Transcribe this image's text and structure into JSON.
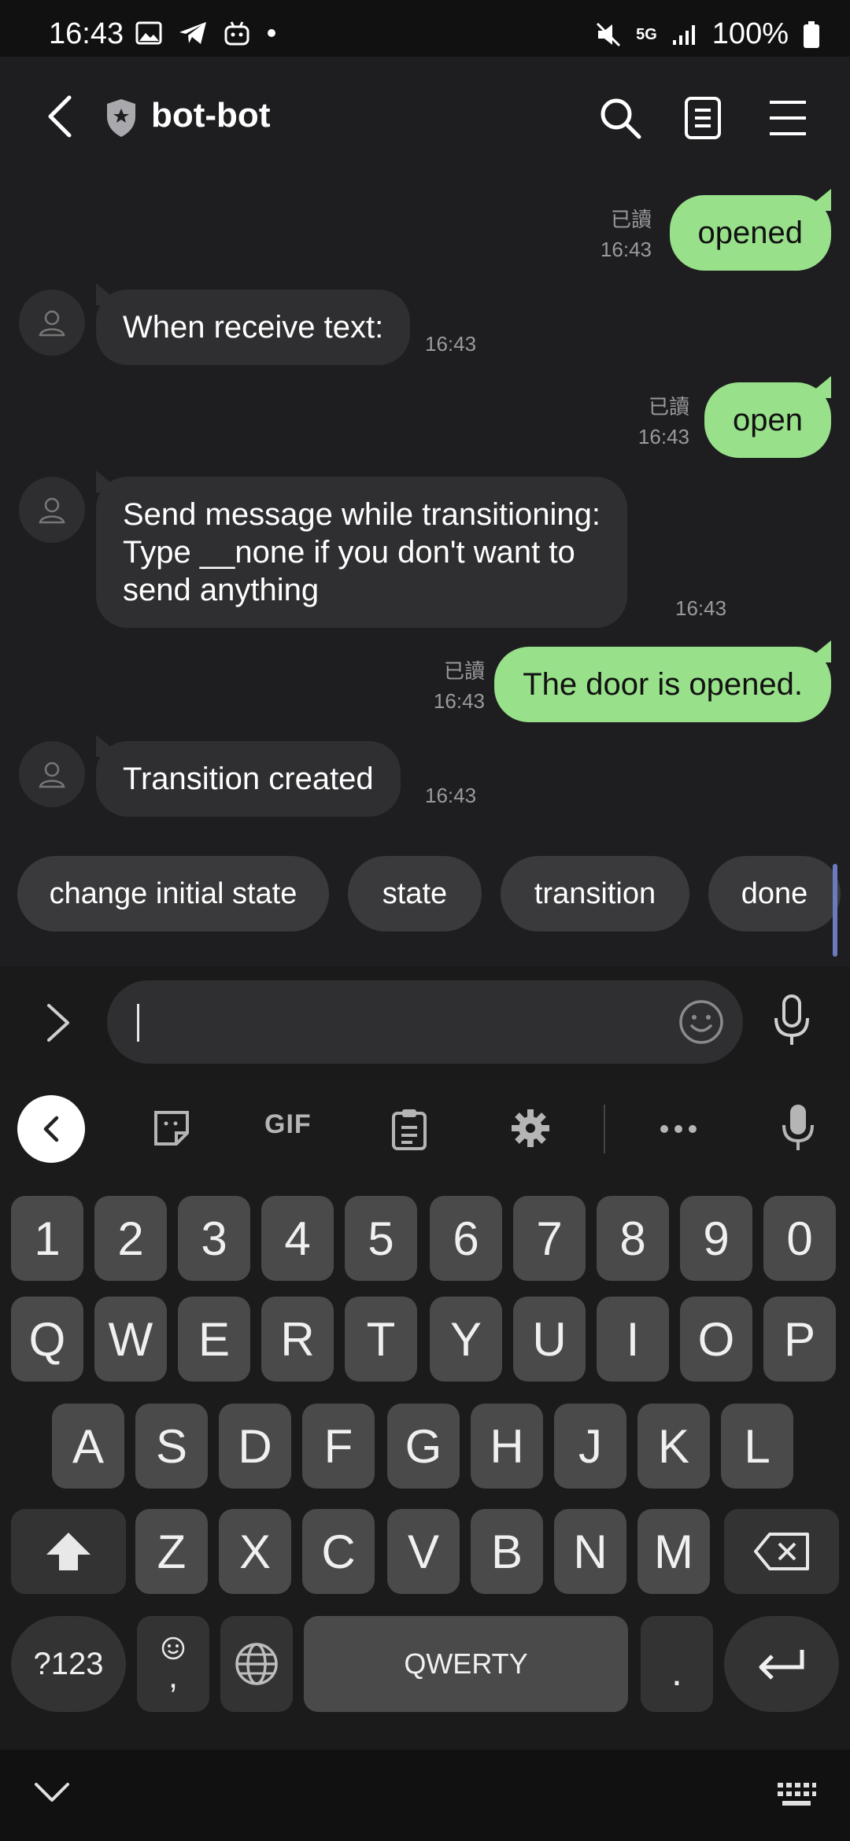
{
  "status_bar": {
    "time": "16:43",
    "network": "5G",
    "battery": "100%"
  },
  "header": {
    "title": "bot-bot"
  },
  "messages": [
    {
      "dir": "out",
      "text": "opened",
      "read_label": "已讀",
      "time": "16:43"
    },
    {
      "dir": "in",
      "text": "When receive text:",
      "time": "16:43"
    },
    {
      "dir": "out",
      "text": "open",
      "read_label": "已讀",
      "time": "16:43"
    },
    {
      "dir": "in",
      "lines": [
        "Send message while transitioning:",
        "Type __none if you don't want to",
        "send anything"
      ],
      "time": "16:43"
    },
    {
      "dir": "out",
      "text": "The door is opened.",
      "read_label": "已讀",
      "time": "16:43"
    },
    {
      "dir": "in",
      "text": "Transition created",
      "time": "16:43"
    }
  ],
  "quick_replies": [
    "change initial state",
    "state",
    "transition",
    "done"
  ],
  "composer": {
    "value": ""
  },
  "keyboard": {
    "toolbar": [
      "back",
      "sticker",
      "GIF",
      "clipboard",
      "settings",
      "more",
      "voice"
    ],
    "gif_label": "GIF",
    "number_row": [
      "1",
      "2",
      "3",
      "4",
      "5",
      "6",
      "7",
      "8",
      "9",
      "0"
    ],
    "row1": [
      "Q",
      "W",
      "E",
      "R",
      "T",
      "Y",
      "U",
      "I",
      "O",
      "P"
    ],
    "row2": [
      "A",
      "S",
      "D",
      "F",
      "G",
      "H",
      "J",
      "K",
      "L"
    ],
    "row3": [
      "Z",
      "X",
      "C",
      "V",
      "B",
      "N",
      "M"
    ],
    "symbols_label": "?123",
    "comma_label": ",",
    "space_label": "QWERTY",
    "period_label": "."
  },
  "colors": {
    "outgoing_bubble": "#98e08a",
    "incoming_bubble": "#2f2f31",
    "background": "#1e1e20"
  }
}
